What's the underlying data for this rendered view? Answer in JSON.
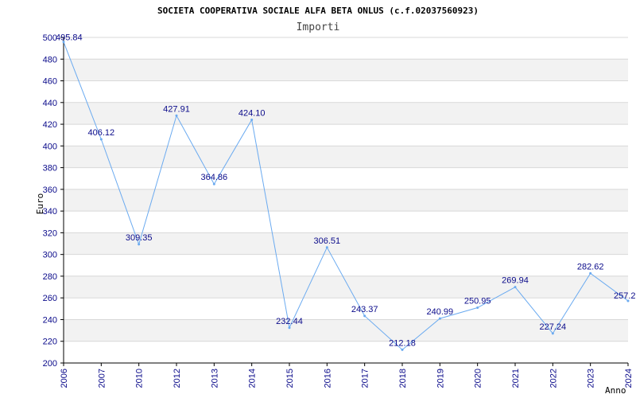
{
  "chart_data": {
    "type": "line",
    "title": "SOCIETA COOPERATIVA SOCIALE ALFA BETA ONLUS (c.f.02037560923)",
    "subtitle": "Importi",
    "xlabel": "Anno",
    "ylabel": "Euro",
    "categories": [
      "2006",
      "2007",
      "2010",
      "2012",
      "2013",
      "2014",
      "2015",
      "2016",
      "2017",
      "2018",
      "2019",
      "2020",
      "2021",
      "2022",
      "2023",
      "2024"
    ],
    "values": [
      495.84,
      406.12,
      309.35,
      427.91,
      364.86,
      424.1,
      232.44,
      306.51,
      243.37,
      212.18,
      240.99,
      250.95,
      269.94,
      227.24,
      282.62,
      257.2
    ],
    "data_labels": [
      "495.84",
      "406.12",
      "309.35",
      "427.91",
      "364.86",
      "424.10",
      "232.44",
      "306.51",
      "243.37",
      "212.18",
      "240.99",
      "250.95",
      "269.94",
      "227.24",
      "282.62",
      "257.2"
    ],
    "ylim": [
      200,
      500
    ],
    "yticks": [
      200,
      220,
      240,
      260,
      280,
      300,
      320,
      340,
      360,
      380,
      400,
      420,
      440,
      460,
      480,
      500
    ],
    "grid": "horizontal bands",
    "legend": "none",
    "colors": {
      "line": "#6aaaf0",
      "band": "#f2f2f2",
      "gridline": "#d8d8d8",
      "axis": "#000000",
      "tick_text": "#0a0a8a"
    }
  }
}
